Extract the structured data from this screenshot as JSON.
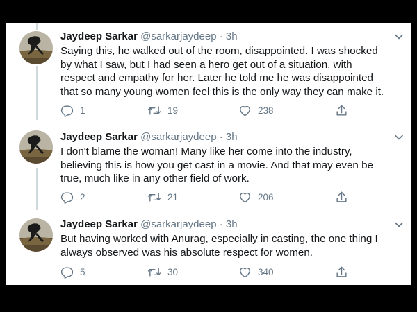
{
  "tweets": [
    {
      "author_name": "Jaydeep Sarkar",
      "handle": "@sarkarjaydeep",
      "separator": "·",
      "time": "3h",
      "lines": [
        "Saying this, he walked out of the room, disappointed. I was shocked",
        "by what I saw, but I had seen a hero get out of a situation, with",
        "respect and empathy for her. Later he told me he was disappointed",
        "that so many young women feel this is the only way they can make it."
      ],
      "replies": "1",
      "retweets": "19",
      "likes": "238"
    },
    {
      "author_name": "Jaydeep Sarkar",
      "handle": "@sarkarjaydeep",
      "separator": "·",
      "time": "3h",
      "lines": [
        "I don't blame the woman! Many like her come into the industry,",
        "believing this is how you get cast in a movie. And that may even be",
        "true, much like in any other field of work."
      ],
      "replies": "2",
      "retweets": "21",
      "likes": "206"
    },
    {
      "author_name": "Jaydeep Sarkar",
      "handle": "@sarkarjaydeep",
      "separator": "·",
      "time": "3h",
      "lines": [
        "But having worked with Anurag, especially in casting, the one thing I",
        "always observed was his absolute respect for women."
      ],
      "replies": "5",
      "retweets": "30",
      "likes": "340"
    }
  ],
  "icons": {
    "reply": "reply-icon",
    "retweet": "retweet-icon",
    "like": "heart-icon",
    "share": "share-icon",
    "more": "chevron-down-icon"
  },
  "colors": {
    "text": "#14171a",
    "secondary": "#657786",
    "thread_line": "#cfd9de",
    "frame": "#000000"
  }
}
